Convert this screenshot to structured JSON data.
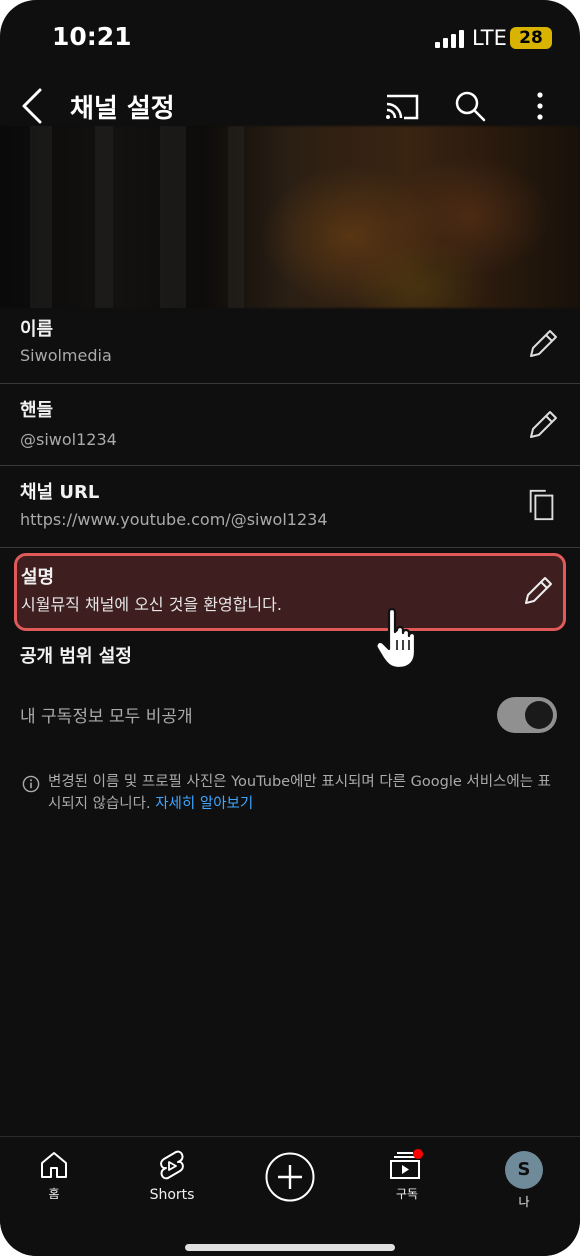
{
  "status_bar": {
    "time": "10:21",
    "network": "LTE",
    "battery": "28"
  },
  "header": {
    "title": "채널 설정",
    "back_icon": "chevron-left-icon",
    "cast_icon": "cast-icon",
    "search_icon": "search-icon",
    "more_icon": "more-vert-icon"
  },
  "fields": [
    {
      "label": "이름",
      "value": "Siwolmedia",
      "action_icon": "pencil-icon"
    },
    {
      "label": "핸들",
      "value": "@siwol1234",
      "action_icon": "pencil-icon"
    },
    {
      "label": "채널 URL",
      "value": "https://www.youtube.com/@siwol1234",
      "action_icon": "copy-icon"
    },
    {
      "label": "설명",
      "value": "시월뮤직 채널에 오신 것을 환영합니다.",
      "action_icon": "pencil-icon"
    }
  ],
  "privacy": {
    "section_title": "공개 범위 설정",
    "subscriptions_label": "내 구독정보 모두 비공개",
    "subscriptions_private": true
  },
  "info": {
    "text": "변경된 이름 및 프로필 사진은 YouTube에만 표시되며 다른 Google 서비스에는 표시되지 않습니다. ",
    "link": "자세히 알아보기"
  },
  "bottom_nav": {
    "home": "홈",
    "shorts": "Shorts",
    "subscriptions": "구독",
    "you": "나",
    "avatar_letter": "S"
  },
  "colors": {
    "background": "#0f0f0f",
    "highlight_border": "#e05a5a",
    "highlight_fill": "#3e1e1e",
    "link": "#3ea6ff",
    "notification_dot": "#ff0000"
  }
}
